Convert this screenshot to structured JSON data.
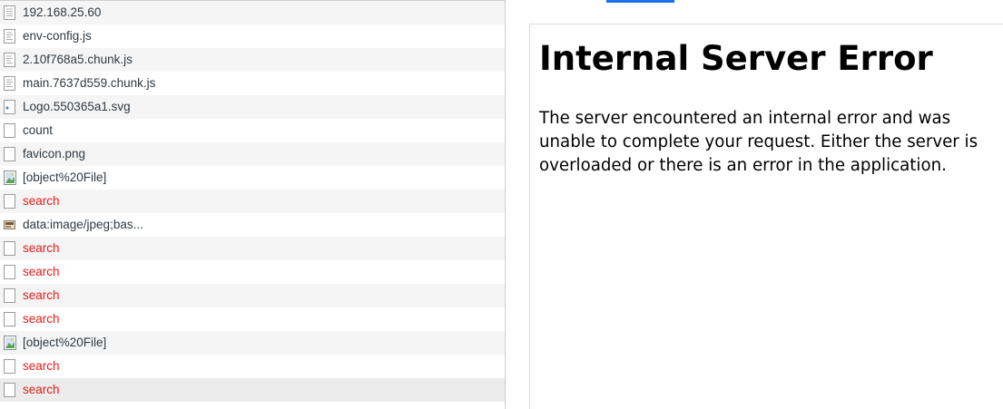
{
  "requests": [
    {
      "name": "192.168.25.60",
      "icon": "document-icon",
      "status": "ok"
    },
    {
      "name": "env-config.js",
      "icon": "script-file-icon",
      "status": "ok"
    },
    {
      "name": "2.10f768a5.chunk.js",
      "icon": "script-file-icon",
      "status": "ok"
    },
    {
      "name": "main.7637d559.chunk.js",
      "icon": "script-file-icon",
      "status": "ok"
    },
    {
      "name": "Logo.550365a1.svg",
      "icon": "svg-file-icon",
      "status": "ok"
    },
    {
      "name": "count",
      "icon": "blank-file-icon",
      "status": "ok"
    },
    {
      "name": "favicon.png",
      "icon": "blank-file-icon",
      "status": "ok"
    },
    {
      "name": "[object%20File]",
      "icon": "image-file-icon",
      "status": "ok"
    },
    {
      "name": "search",
      "icon": "blank-file-icon",
      "status": "error"
    },
    {
      "name": "data:image/jpeg;bas...",
      "icon": "jpeg-thumbnail-icon",
      "status": "ok"
    },
    {
      "name": "search",
      "icon": "blank-file-icon",
      "status": "error"
    },
    {
      "name": "search",
      "icon": "blank-file-icon",
      "status": "error"
    },
    {
      "name": "search",
      "icon": "blank-file-icon",
      "status": "error"
    },
    {
      "name": "search",
      "icon": "blank-file-icon",
      "status": "error"
    },
    {
      "name": "[object%20File]",
      "icon": "image-file-icon",
      "status": "ok"
    },
    {
      "name": "search",
      "icon": "blank-file-icon",
      "status": "error"
    },
    {
      "name": "search",
      "icon": "blank-file-icon",
      "status": "error"
    }
  ],
  "preview": {
    "title": "Internal Server Error",
    "message": "The server encountered an internal error and was unable to complete your request. Either the server is overloaded or there is an error in the application."
  },
  "colors": {
    "error_text": "#e0201c",
    "active_tab": "#1a73e8",
    "row_stripe": "#f5f5f5",
    "row_hover": "#ececec"
  }
}
